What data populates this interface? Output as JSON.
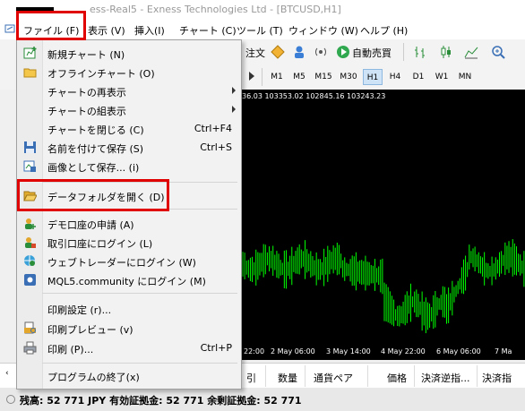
{
  "window": {
    "title": "ess-Real5 - Exness Technologies Ltd - [BTCUSD,H1]"
  },
  "menubar": {
    "items": [
      {
        "label": "ファイル (F)"
      },
      {
        "label": "表示 (V)"
      },
      {
        "label": "挿入(I)"
      },
      {
        "label": "チャート (C)"
      },
      {
        "label": "ツール (T)"
      },
      {
        "label": "ウィンドウ (W)"
      },
      {
        "label": "ヘルプ (H)"
      }
    ]
  },
  "toolbar": {
    "new_order_label": "注文",
    "autotrade_label": "自動売買",
    "timeframes": [
      "M1",
      "M5",
      "M15",
      "M30",
      "H1",
      "H4",
      "D1",
      "W1",
      "MN"
    ],
    "active_timeframe": "H1"
  },
  "file_menu": {
    "items": [
      {
        "label": "新規チャート (N)",
        "icon": "new-chart-icon",
        "shortcut": ""
      },
      {
        "label": "オフラインチャート (O)",
        "icon": "folder-icon",
        "shortcut": ""
      },
      {
        "label": "チャートの再表示",
        "icon": "",
        "shortcut": "",
        "submenu": true
      },
      {
        "label": "チャートの組表示",
        "icon": "",
        "shortcut": "",
        "submenu": true
      },
      {
        "label": "チャートを閉じる (C)",
        "icon": "",
        "shortcut": "Ctrl+F4"
      },
      {
        "label": "名前を付けて保存 (S)",
        "icon": "save-icon",
        "shortcut": "Ctrl+S"
      },
      {
        "label": "画像として保存... (i)",
        "icon": "image-save-icon",
        "shortcut": ""
      },
      {
        "label": "データフォルダを開く (D)",
        "icon": "open-folder-icon",
        "shortcut": ""
      },
      {
        "label": "デモ口座の申請 (A)",
        "icon": "demo-account-icon",
        "shortcut": ""
      },
      {
        "label": "取引口座にログイン (L)",
        "icon": "login-icon",
        "shortcut": ""
      },
      {
        "label": "ウェブトレーダーにログイン (W)",
        "icon": "web-trader-icon",
        "shortcut": ""
      },
      {
        "label": "MQL5.community にログイン (M)",
        "icon": "mql5-icon",
        "shortcut": ""
      },
      {
        "label": "印刷設定 (r)...",
        "icon": "",
        "shortcut": ""
      },
      {
        "label": "印刷プレビュー (v)",
        "icon": "print-preview-icon",
        "shortcut": ""
      },
      {
        "label": "印刷 (P)...",
        "icon": "print-icon",
        "shortcut": "Ctrl+P"
      },
      {
        "label": "プログラムの終了(x)",
        "icon": "",
        "shortcut": ""
      }
    ]
  },
  "chart": {
    "header_text": "36.03 103353.02 102845.16 103243.23",
    "x_labels": [
      "22:00",
      "2 May 06:00",
      "3 May 14:00",
      "4 May 22:00",
      "6 May 06:00",
      "7 Ma"
    ],
    "bull_color": "#00ff00",
    "bg_color": "#000000"
  },
  "terminal": {
    "columns": [
      "引",
      "数量",
      "通貨ペア",
      "価格",
      "決済逆指...",
      "決済指"
    ]
  },
  "status": {
    "text": "残高: 52 771 JPY  有効証拠金: 52 771  余剰証拠金: 52 771"
  },
  "accent_color": "#e00000"
}
